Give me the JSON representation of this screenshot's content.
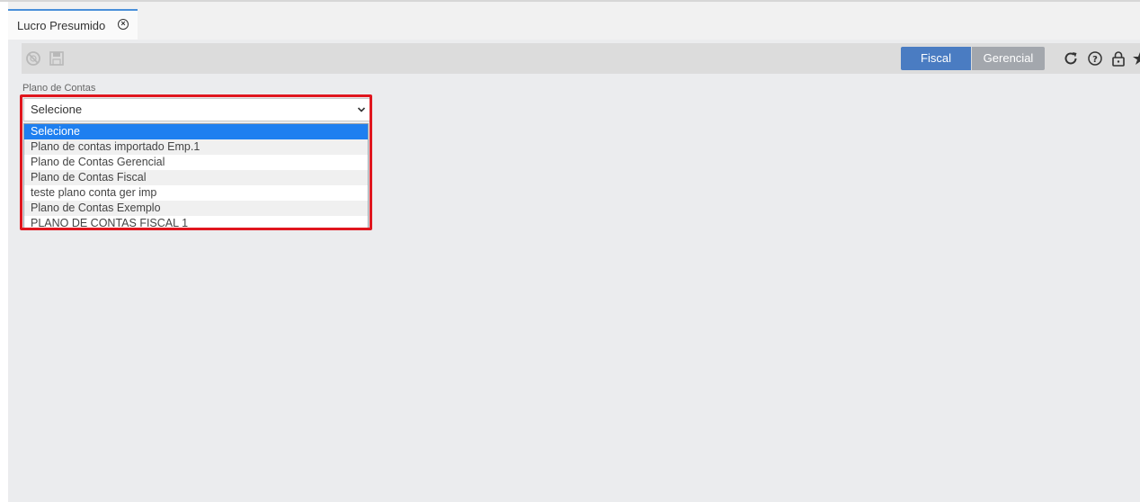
{
  "tab": {
    "title": "Lucro Presumido",
    "close_icon": "close-circle-icon"
  },
  "toolbar": {
    "left_icons": [
      "disabled-circle-icon",
      "save-disk-icon"
    ],
    "segments": [
      {
        "label": "Fiscal",
        "active": true
      },
      {
        "label": "Gerencial",
        "active": false
      }
    ],
    "right_icons": [
      "refresh-icon",
      "help-icon",
      "lock-icon",
      "star-icon"
    ]
  },
  "form": {
    "label": "Plano de Contas",
    "select_value": "Selecione",
    "options": [
      "Selecione",
      "Plano de contas importado Emp.1",
      "Plano de Contas Gerencial",
      "Plano de Contas Fiscal",
      "teste plano conta ger imp",
      "Plano de Contas Exemplo",
      "PLANO DE CONTAS FISCAL 1"
    ],
    "selected_index": 0
  },
  "colors": {
    "highlight": "#e0161e",
    "fiscal": "#4a7cc2",
    "gerencial": "#a3a7ad",
    "selected_option": "#1e7ff0"
  }
}
